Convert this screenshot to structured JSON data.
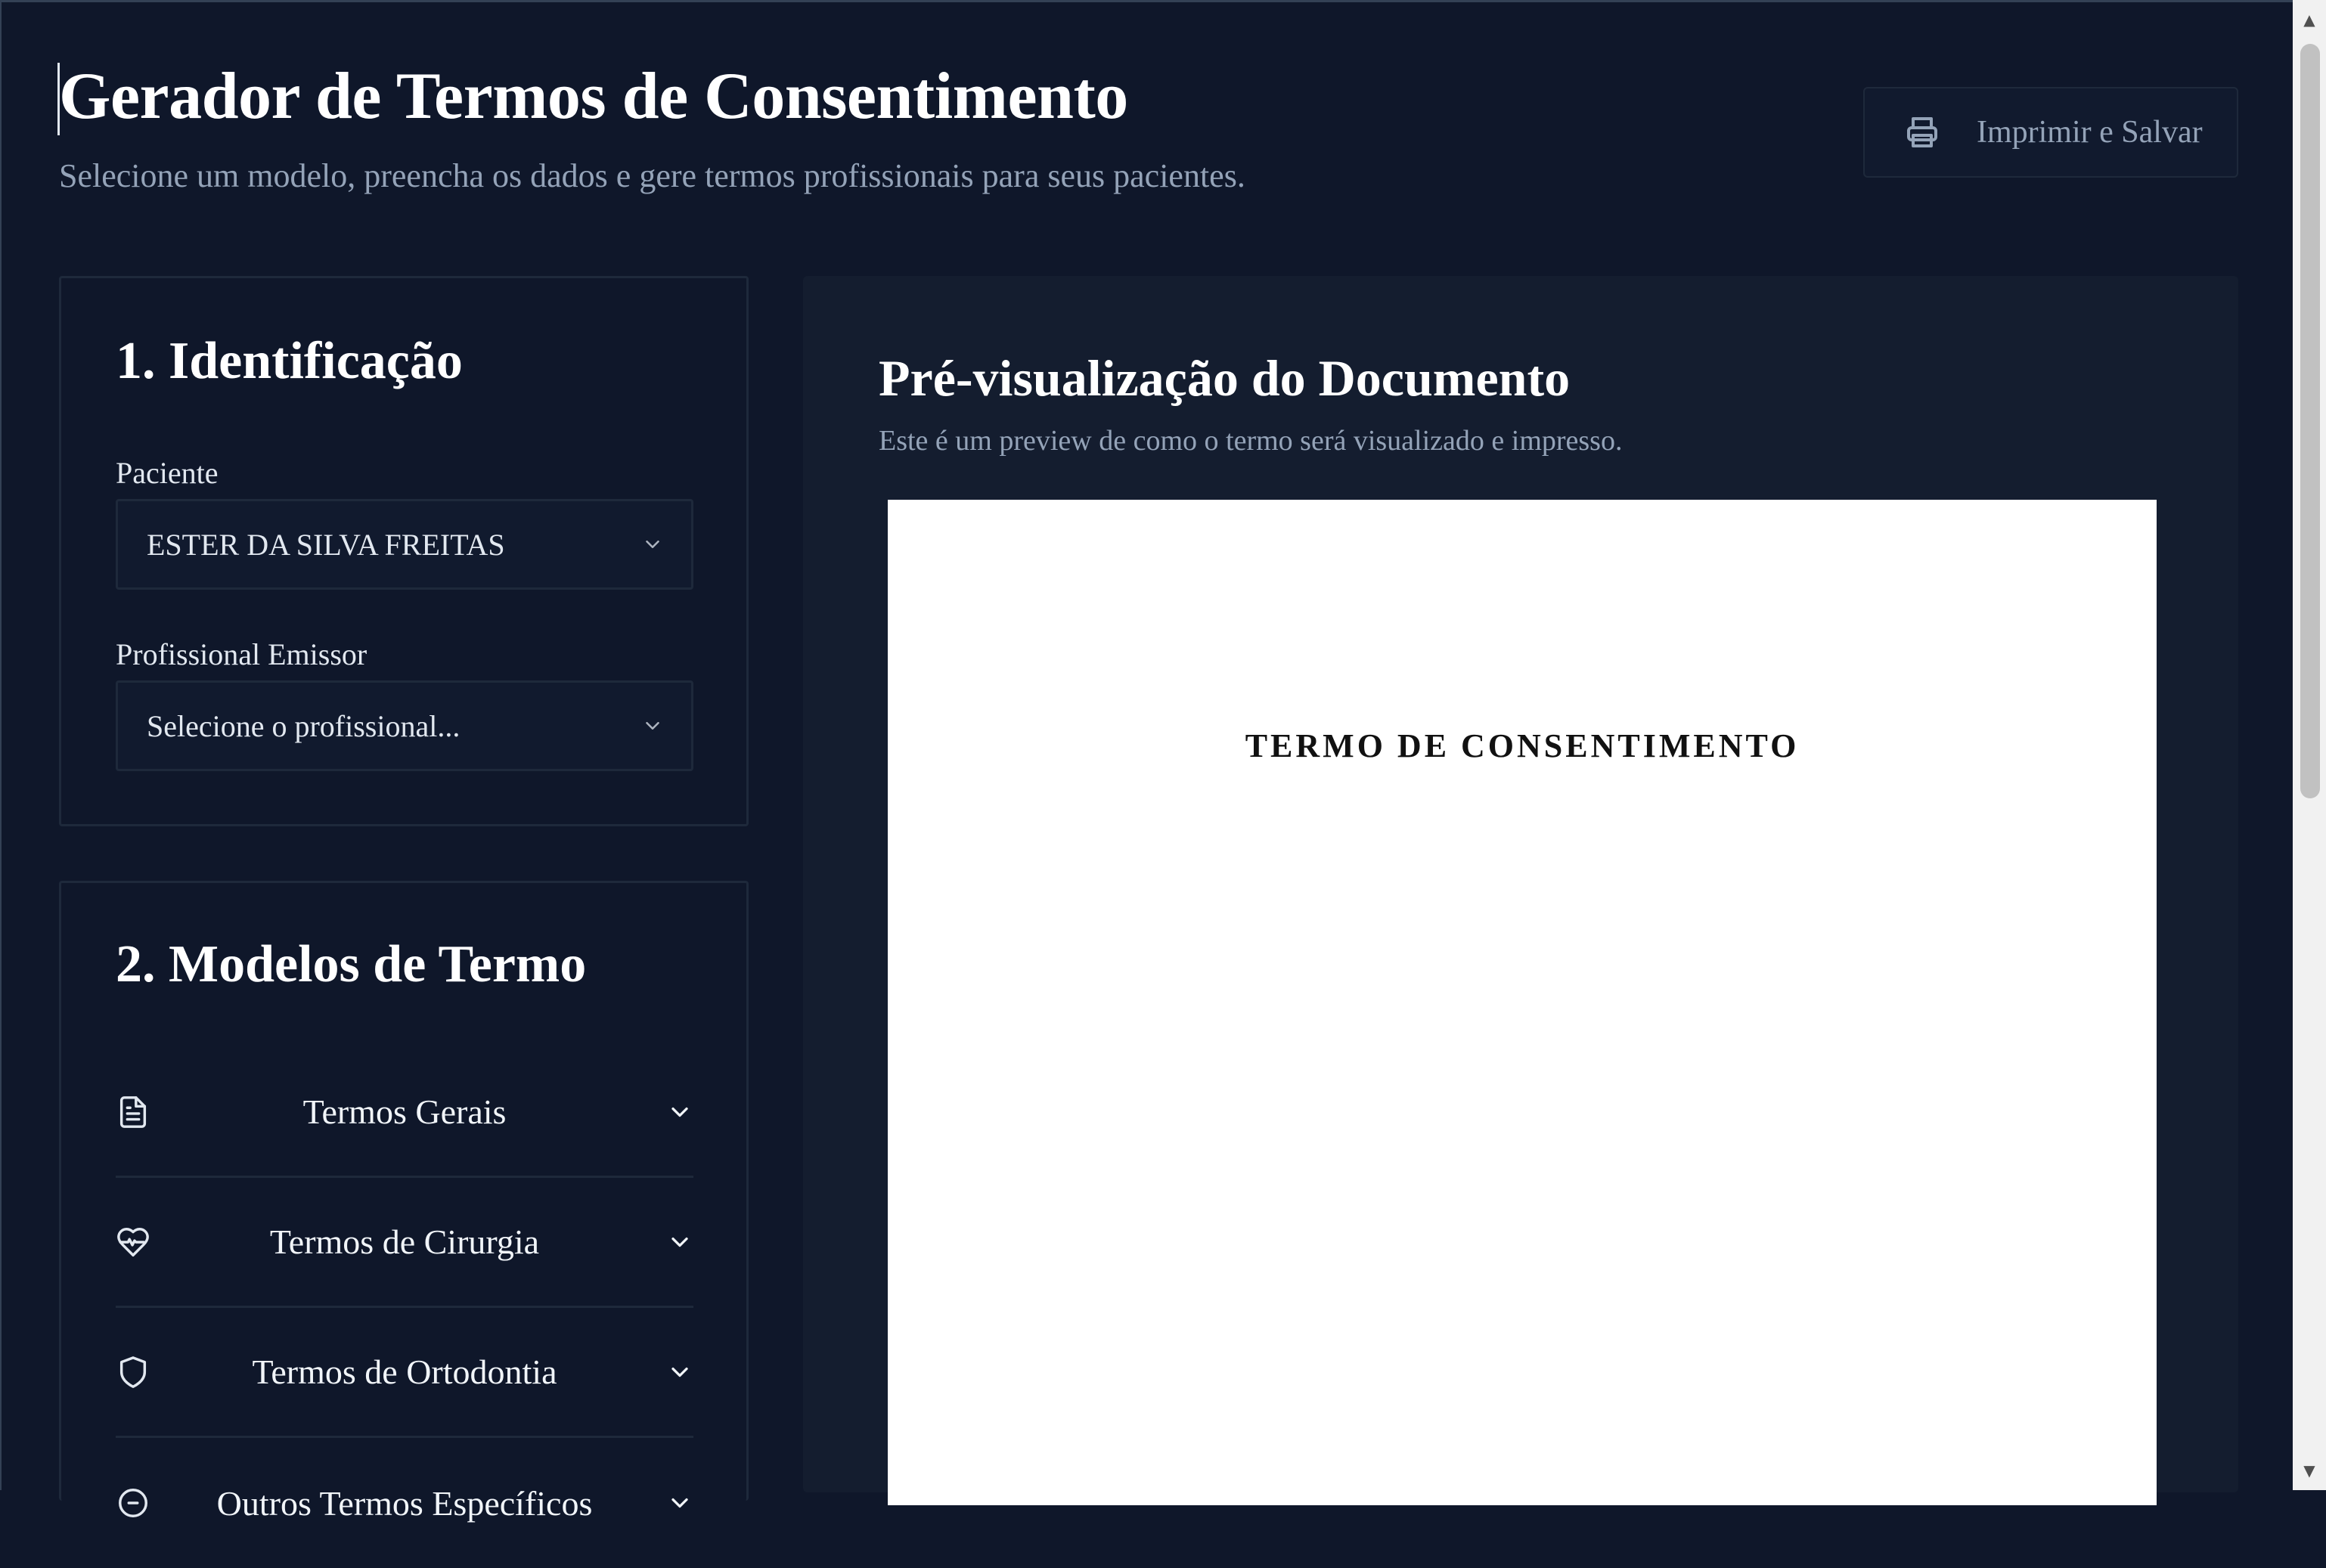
{
  "header": {
    "title": "Gerador de Termos de Consentimento",
    "subtitle": "Selecione um modelo, preencha os dados e gere termos profissionais para seus pacientes.",
    "print_button": {
      "label": "Imprimir e Salvar",
      "icon": "printer-icon"
    }
  },
  "identification": {
    "title": "1. Identificação",
    "patient": {
      "label": "Paciente",
      "value": "ESTER DA SILVA FREITAS"
    },
    "professional": {
      "label": "Profissional Emissor",
      "placeholder": "Selecione o profissional..."
    }
  },
  "models": {
    "title": "2. Modelos de Termo",
    "items": [
      {
        "label": "Termos Gerais",
        "icon": "file-text-icon"
      },
      {
        "label": "Termos de Cirurgia",
        "icon": "heart-pulse-icon"
      },
      {
        "label": "Termos de Ortodontia",
        "icon": "shield-icon"
      },
      {
        "label": "Outros Termos Específicos",
        "icon": "circle-icon"
      }
    ]
  },
  "preview": {
    "title": "Pré-visualização do Documento",
    "subtitle": "Este é um preview de como o termo será visualizado e impresso.",
    "document_title": "TERMO DE CONSENTIMENTO"
  },
  "colors": {
    "background": "#0f172a",
    "card_border": "#1e293b",
    "muted_text": "#94a3b8",
    "paper": "#ffffff"
  }
}
